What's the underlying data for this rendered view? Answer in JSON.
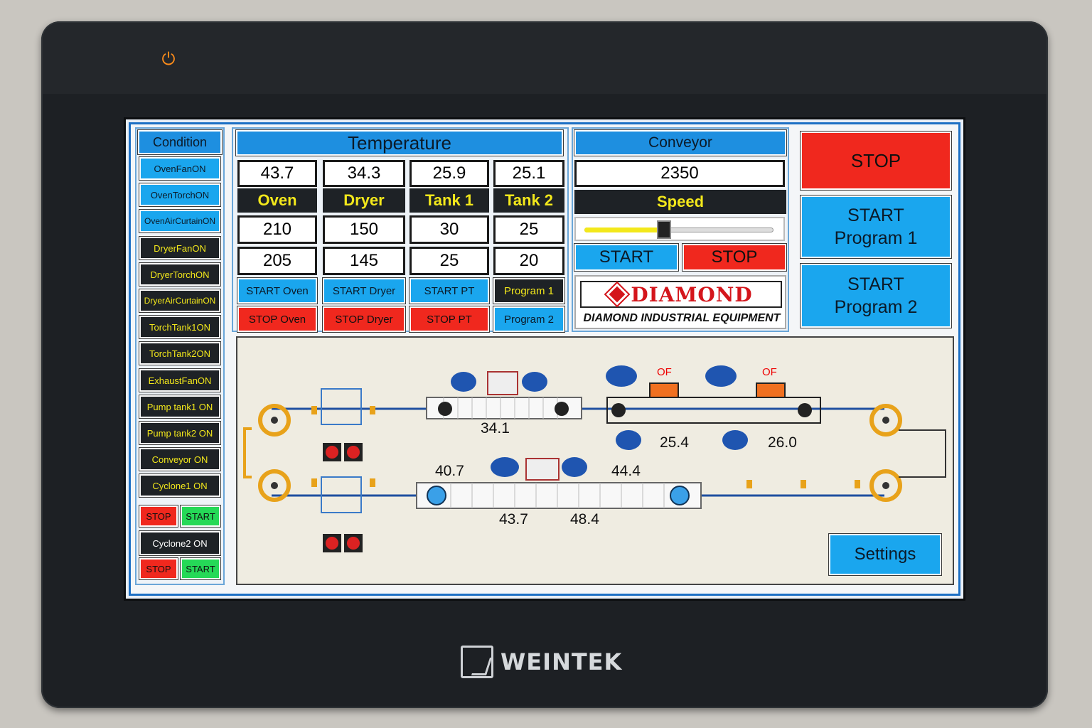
{
  "device": {
    "brand": "WEINTEK",
    "power_icon": "power-icon"
  },
  "condition": {
    "header": "Condition",
    "items": [
      {
        "label": "OvenFanON",
        "state": "on"
      },
      {
        "label": "OvenTorchON",
        "state": "on"
      },
      {
        "label": "OvenAirCurtainON",
        "state": "on"
      },
      {
        "label": "DryerFanON",
        "state": "off"
      },
      {
        "label": "DryerTorchON",
        "state": "off"
      },
      {
        "label": "DryerAirCurtainON",
        "state": "off"
      },
      {
        "label": "TorchTank1ON",
        "state": "off"
      },
      {
        "label": "TorchTank2ON",
        "state": "off"
      },
      {
        "label": "ExhaustFanON",
        "state": "off"
      },
      {
        "label": "Pump tank1 ON",
        "state": "off"
      },
      {
        "label": "Pump tank2 ON",
        "state": "off"
      },
      {
        "label": "Conveyor ON",
        "state": "off"
      },
      {
        "label": "Cyclone1 ON",
        "state": "off"
      }
    ],
    "cyclone1_stop": "STOP",
    "cyclone1_start": "START",
    "cyclone2_label": "Cyclone2 ON",
    "cyclone2_stop": "STOP",
    "cyclone2_start": "START"
  },
  "temperature": {
    "header": "Temperature",
    "actual": [
      "43.7",
      "34.3",
      "25.9",
      "25.1"
    ],
    "names": [
      "Oven",
      "Dryer",
      "Tank 1",
      "Tank 2"
    ],
    "setpoint_high": [
      "210",
      "150",
      "30",
      "25"
    ],
    "setpoint_low": [
      "205",
      "145",
      "25",
      "20"
    ],
    "start_buttons": [
      "START Oven",
      "START Dryer",
      "START PT",
      "Program 1"
    ],
    "stop_buttons": [
      "STOP Oven",
      "STOP Dryer",
      "STOP PT",
      "Program 2"
    ]
  },
  "conveyor": {
    "header": "Conveyor",
    "value": "2350",
    "speed_label": "Speed",
    "speed_level": 0.42,
    "start": "START",
    "stop": "STOP"
  },
  "logo": {
    "name": "DIAMOND",
    "tagline": "DIAMOND INDUSTRIAL EQUIPMENT"
  },
  "main_controls": {
    "stop": "STOP",
    "program1": "START\nProgram 1",
    "program2": "START\nProgram 2"
  },
  "diagram": {
    "readings": [
      "34.1",
      "25.4",
      "26.0",
      "40.7",
      "44.4",
      "43.7",
      "48.4"
    ],
    "overflow_labels": [
      "OF",
      "OF"
    ],
    "settings": "Settings"
  },
  "colors": {
    "accent_blue": "#1aa6ee",
    "stop_red": "#f0281e",
    "start_green": "#25d957",
    "label_yellow": "#f3e81b",
    "dark": "#1e2226"
  }
}
